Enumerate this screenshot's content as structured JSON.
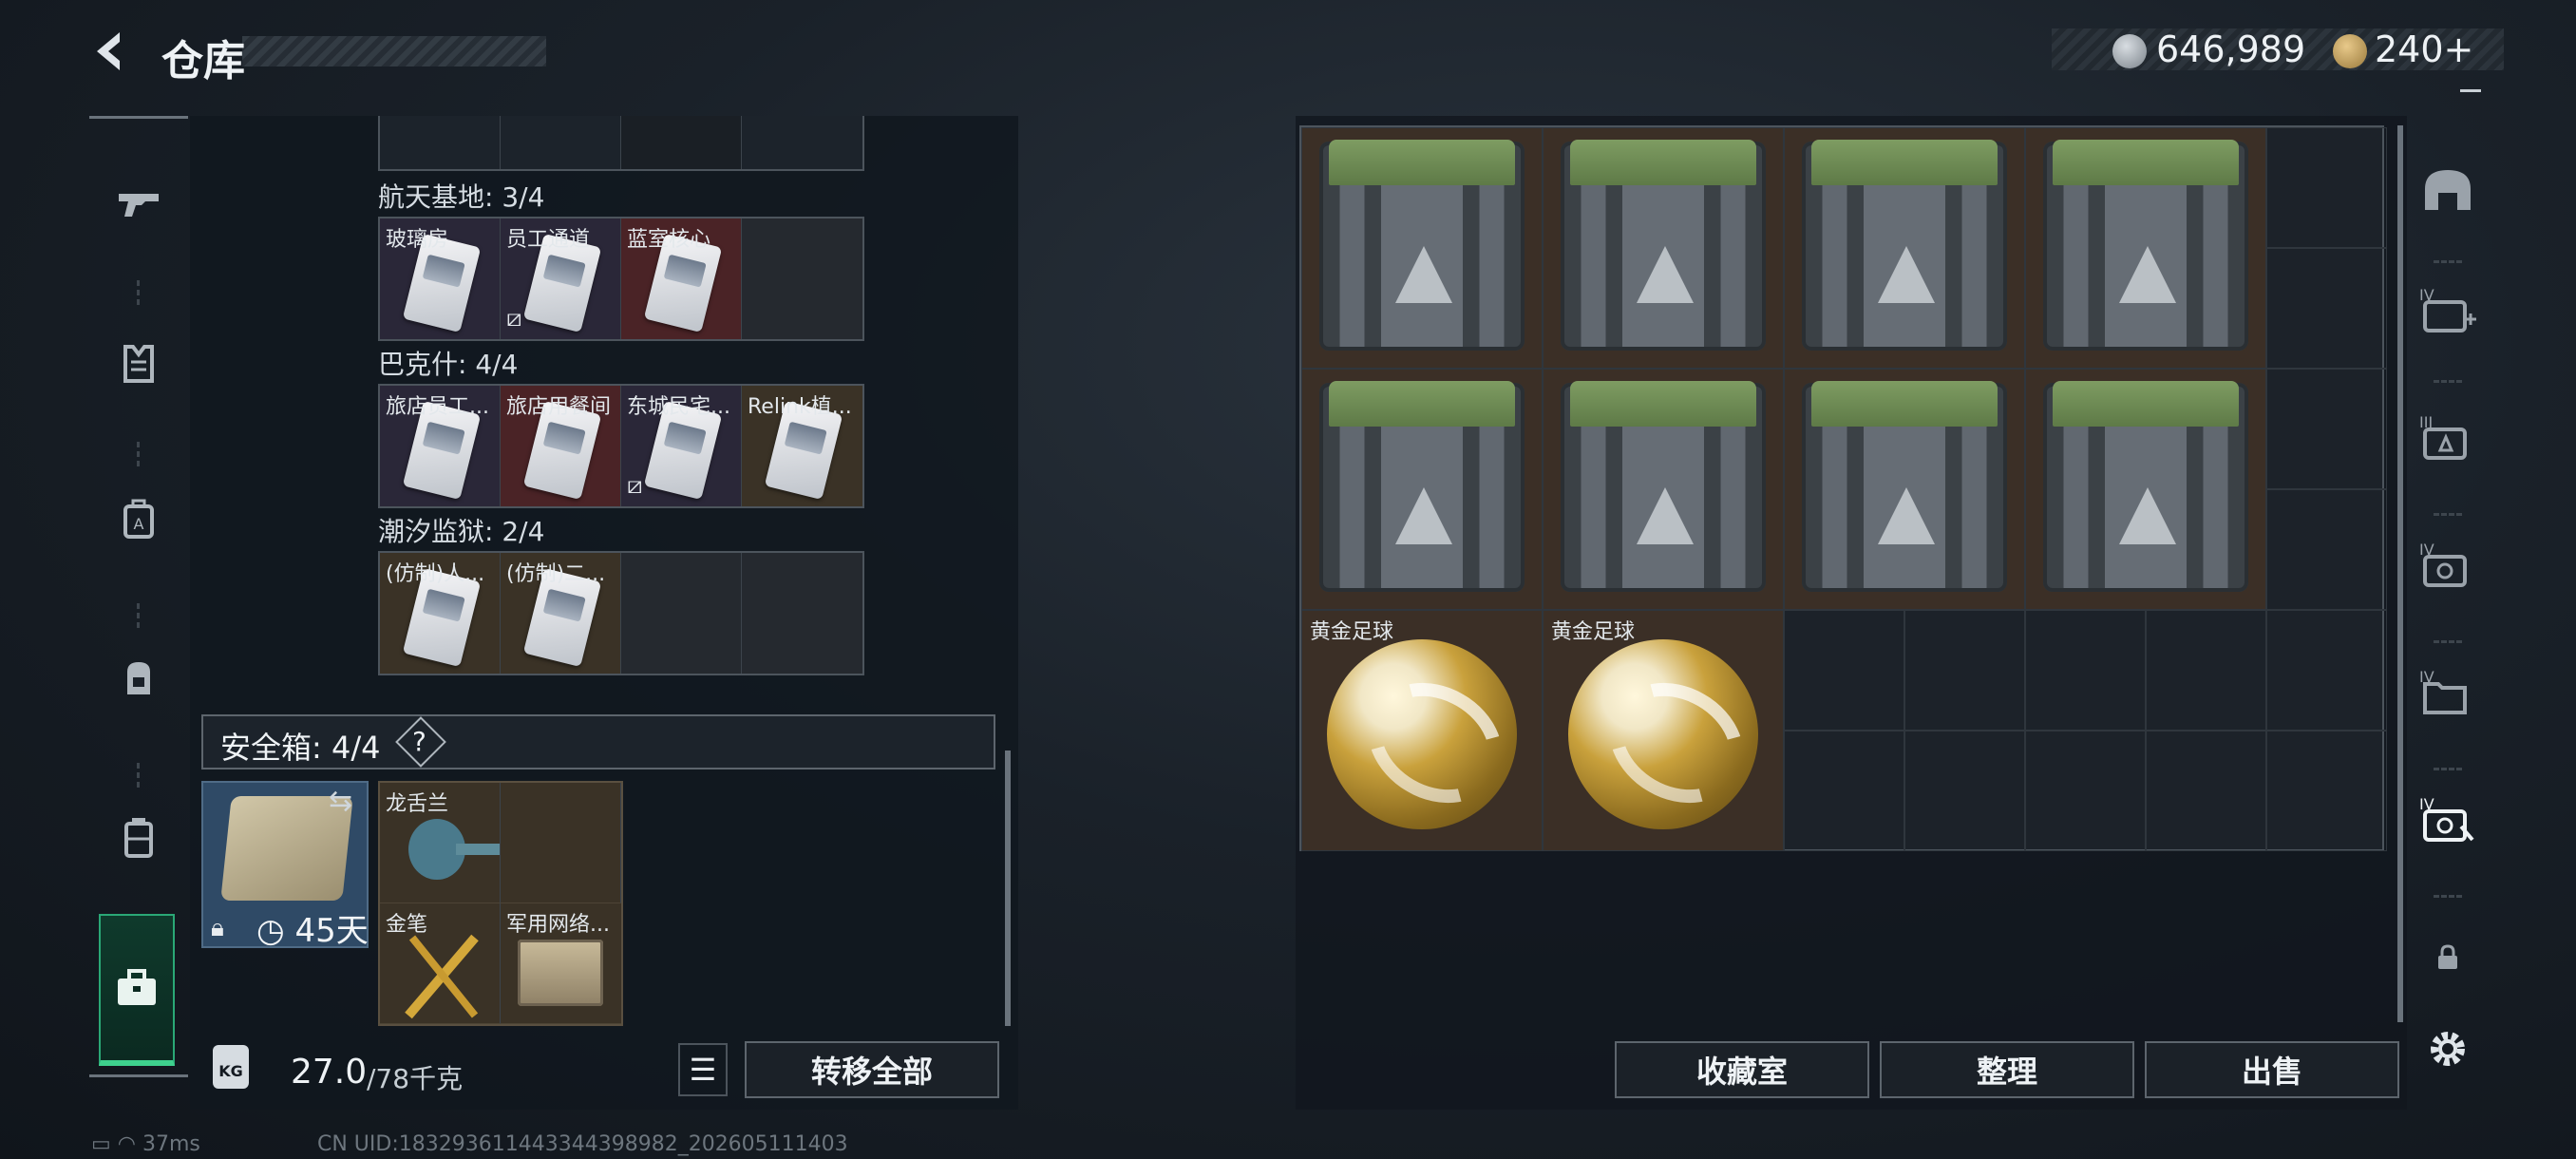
{
  "header": {
    "title": "仓库"
  },
  "currency": {
    "silver": "646,989",
    "gold": "240+"
  },
  "collections": [
    {
      "label": "航天基地: 3/4",
      "items": [
        {
          "name": "玻璃房",
          "bg": "purple",
          "unbound": false
        },
        {
          "name": "员工通道",
          "bg": "purple",
          "unbound": true
        },
        {
          "name": "蓝室核心",
          "bg": "red",
          "unbound": false
        },
        {
          "name": "",
          "bg": "empty",
          "unbound": false
        }
      ]
    },
    {
      "label": "巴克什: 4/4",
      "items": [
        {
          "name": "旅店员工...",
          "bg": "purple",
          "unbound": false
        },
        {
          "name": "旅店用餐间",
          "bg": "red",
          "unbound": false
        },
        {
          "name": "东城民宅...",
          "bg": "purple",
          "unbound": true
        },
        {
          "name": "Relink植...",
          "bg": "gold",
          "unbound": false
        }
      ]
    },
    {
      "label": "潮汐监狱: 2/4",
      "items": [
        {
          "name": "(仿制)人...",
          "bg": "gold",
          "unbound": false
        },
        {
          "name": "(仿制)二...",
          "bg": "gold",
          "unbound": false
        },
        {
          "name": "",
          "bg": "empty",
          "unbound": false
        },
        {
          "name": "",
          "bg": "empty",
          "unbound": false
        }
      ]
    }
  ],
  "safebox": {
    "label": "安全箱:  4/4",
    "help": "?",
    "days": "45天",
    "items": [
      {
        "name": "龙舌兰"
      },
      {
        "name": ""
      },
      {
        "name": "金笔"
      },
      {
        "name": "军用网络..."
      }
    ]
  },
  "weight": {
    "current": "27.0",
    "max": "/78千克",
    "icon": "KG"
  },
  "buttons": {
    "transfer_all": "转移全部",
    "collection_room": "收藏室",
    "organize": "整理",
    "sell": "出售"
  },
  "storage": {
    "crates": 8,
    "balls": [
      {
        "name": "黄金足球"
      },
      {
        "name": "黄金足球"
      }
    ]
  },
  "status": {
    "ping": "37ms",
    "uid": "CN UID:183293611443344398982_202605111403"
  },
  "icons": {
    "back": "back-arrow-icon",
    "left_nav": [
      "gun-icon",
      "armor-icon",
      "chest-rig-icon",
      "backpack-icon",
      "bag-icon",
      "toolbox-icon"
    ],
    "right_nav": [
      "helmet-icon",
      "container-add-icon",
      "container-iii-icon",
      "container-iv-icon",
      "container-iv-folder-icon",
      "container-iv-active-icon",
      "lock-icon",
      "gear-icon"
    ]
  },
  "colors": {
    "accent_green": "#3ed08d",
    "purple_bg": "#2a2738",
    "red_bg": "#4a2326",
    "gold_bg": "#3a3226"
  }
}
